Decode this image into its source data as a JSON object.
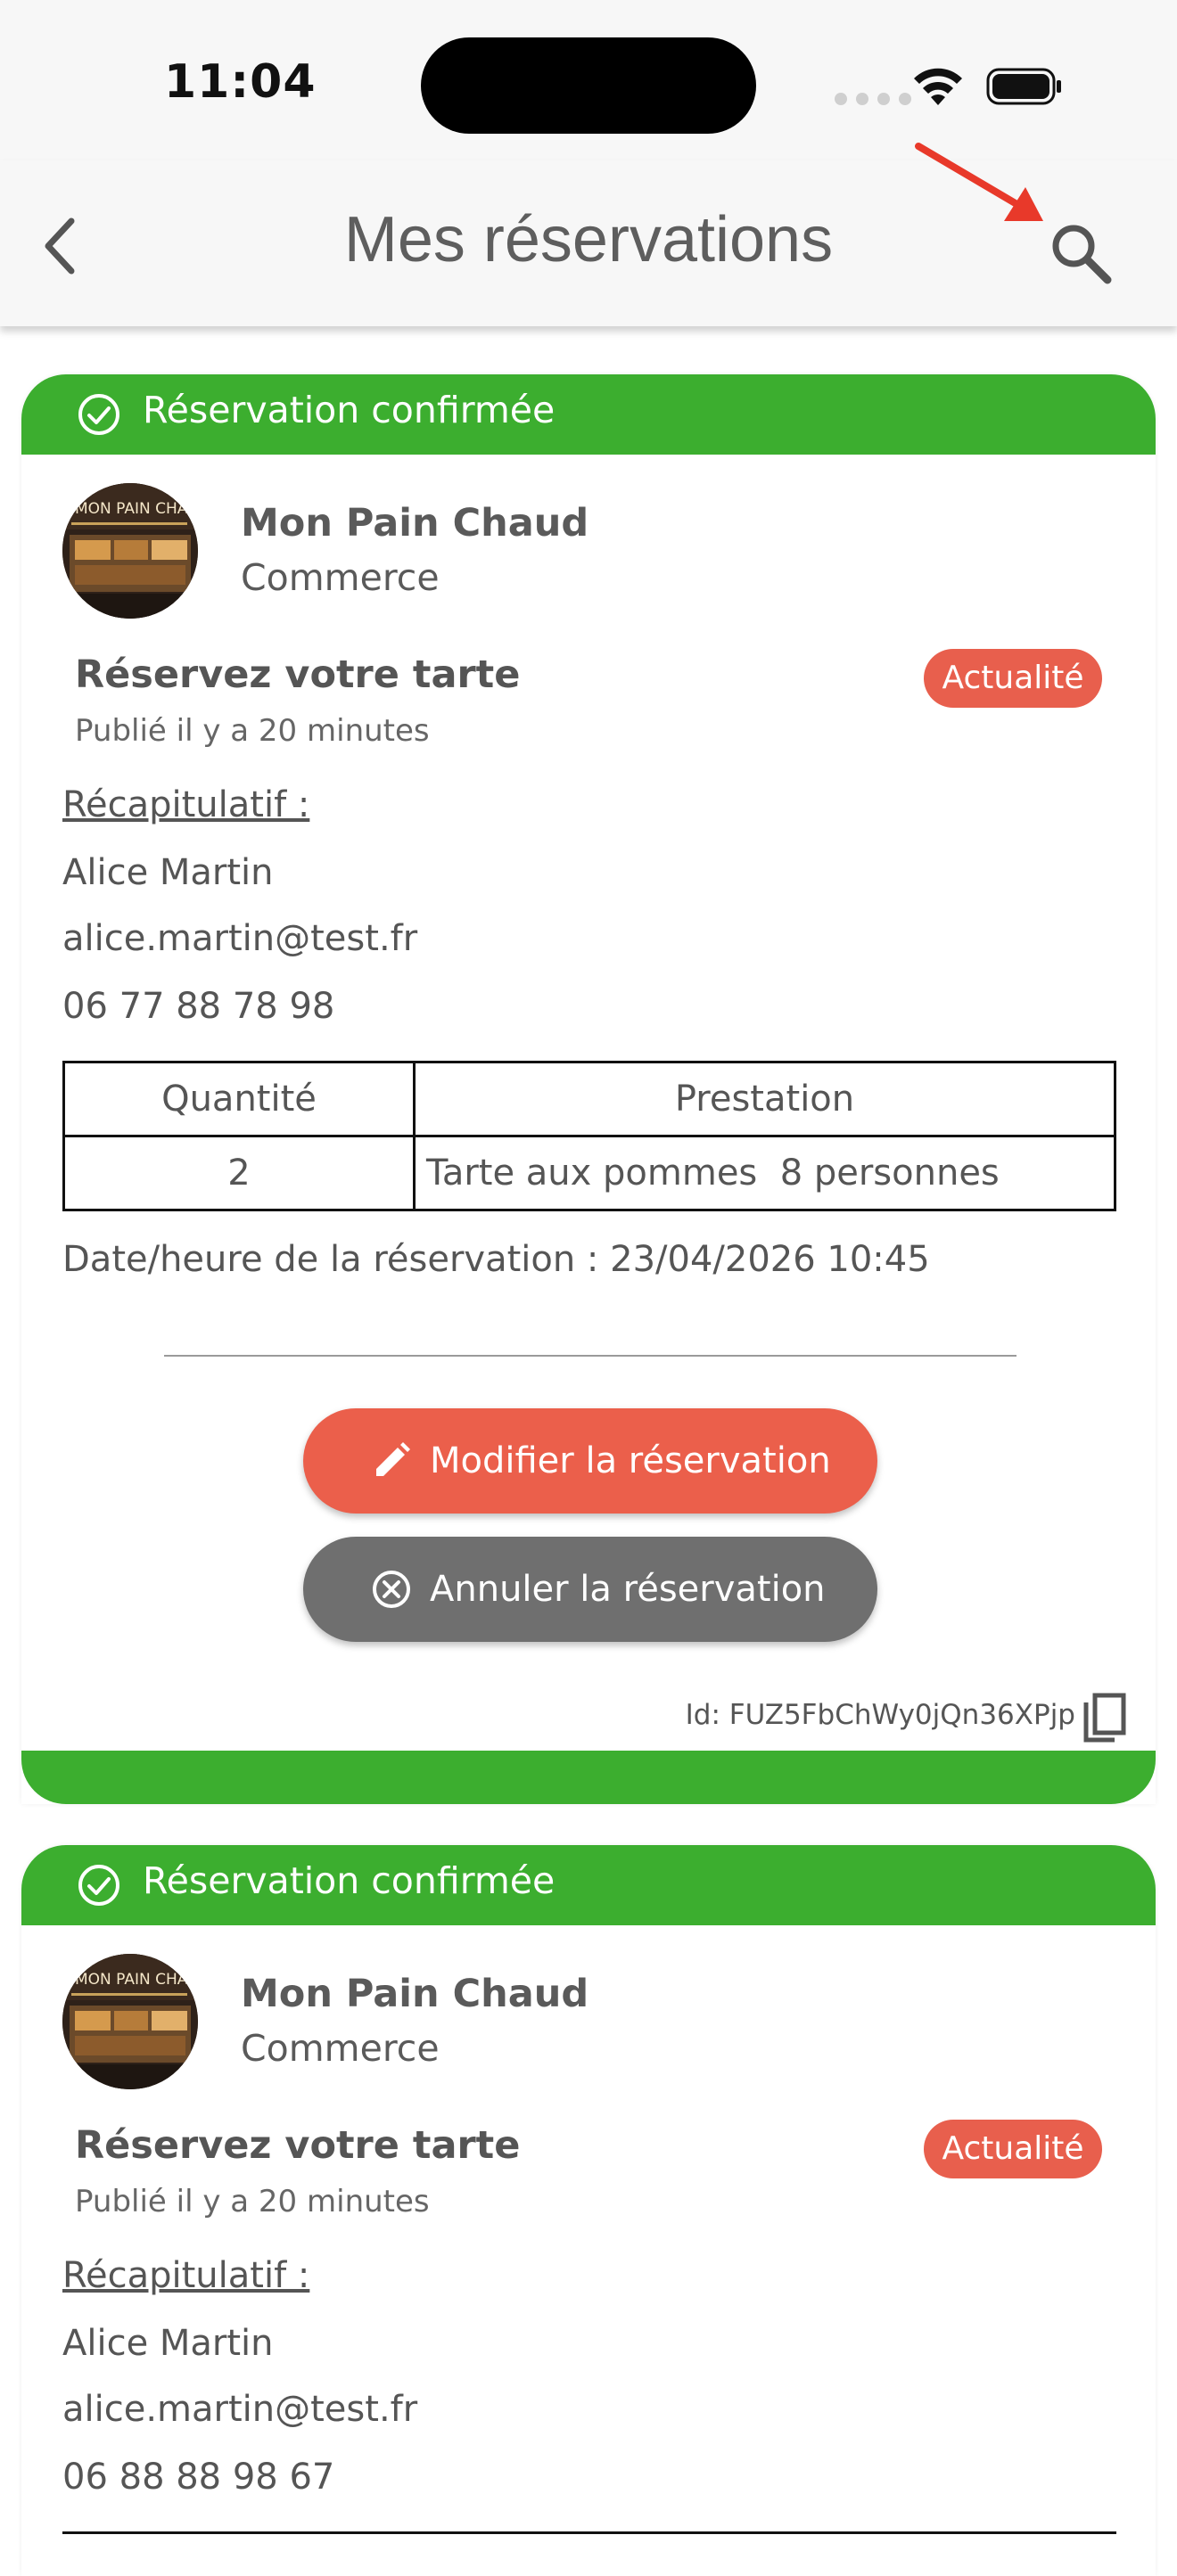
{
  "status_bar": {
    "time": "11:04"
  },
  "header": {
    "title": "Mes réservations"
  },
  "colors": {
    "banner": "#3cae2f",
    "badge": "#e85f4d",
    "edit": "#eb5f4b",
    "cancel": "#6f6f6f",
    "arrow": "#e8392a"
  },
  "reservations": [
    {
      "status": "Réservation confirmée",
      "merchant_name": "Mon Pain Chaud",
      "merchant_type": "Commerce",
      "avatar_sign": "MON PAIN CHA",
      "post_title": "Réservez votre tarte",
      "post_date": "Publié il y a 20 minutes",
      "badge": "Actualité",
      "summary_label": "Récapitulatif :",
      "customer_name": "Alice Martin",
      "email": "alice.martin@test.fr",
      "phone": "06 77 88 78 98",
      "table": {
        "headers": [
          "Quantité",
          "Prestation"
        ],
        "rows": [
          [
            "2",
            "Tarte aux pommes  8 personnes"
          ]
        ]
      },
      "booking_datetime": "Date/heure de la réservation : 23/04/2026 10:45",
      "edit_label": "Modifier la réservation",
      "cancel_label": "Annuler la réservation",
      "id_text": "Id: FUZ5FbChWy0jQn36XPjp"
    },
    {
      "status": "Réservation confirmée",
      "merchant_name": "Mon Pain Chaud",
      "merchant_type": "Commerce",
      "avatar_sign": "MON PAIN CHA",
      "post_title": "Réservez votre tarte",
      "post_date": "Publié il y a 20 minutes",
      "badge": "Actualité",
      "summary_label": "Récapitulatif :",
      "customer_name": "Alice Martin",
      "email": "alice.martin@test.fr",
      "phone": "06 88 88 98 67"
    }
  ]
}
